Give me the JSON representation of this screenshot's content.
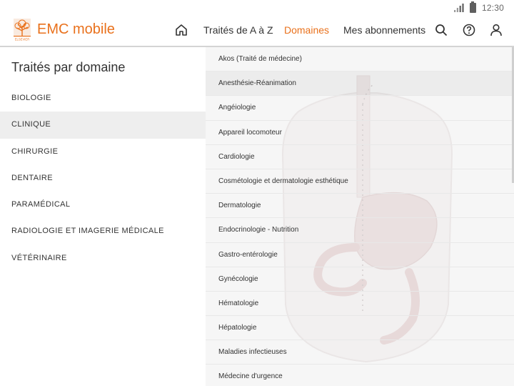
{
  "status": {
    "time": "12:30",
    "icons": [
      "signal-icon",
      "battery-icon"
    ]
  },
  "header": {
    "brand": "EMC mobile",
    "logo_icon": "elsevier-tree-logo",
    "logo_text": "ELSEVIER",
    "accent_color": "#e9711c",
    "nav": {
      "home_icon": "home-icon",
      "links": [
        "Traités de A à Z",
        "Domaines",
        "Mes abonnements"
      ],
      "active": "Domaines",
      "right_icons": [
        "search-icon",
        "help-icon",
        "user-icon"
      ]
    }
  },
  "left_panel": {
    "title": "Traités par domaine",
    "items": [
      "BIOLOGIE",
      "CLINIQUE",
      "CHIRURGIE",
      "DENTAIRE",
      "PARAMÉDICAL",
      "RADIOLOGIE ET IMAGERIE MÉDICALE",
      "VÉTÉRINAIRE"
    ],
    "selected": "CLINIQUE"
  },
  "right_panel": {
    "items": [
      "Akos (Traité de médecine)",
      "Anesthésie-Réanimation",
      "Angéiologie",
      "Appareil locomoteur",
      "Cardiologie",
      "Cosmétologie et dermatologie esthétique",
      "Dermatologie",
      "Endocrinologie - Nutrition",
      "Gastro-entérologie",
      "Gynécologie",
      "Hématologie",
      "Hépatologie",
      "Maladies infectieuses",
      "Médecine d'urgence"
    ],
    "highlighted": "Anesthésie-Réanimation",
    "background_illustration": "anatomy-torso-illustration"
  }
}
